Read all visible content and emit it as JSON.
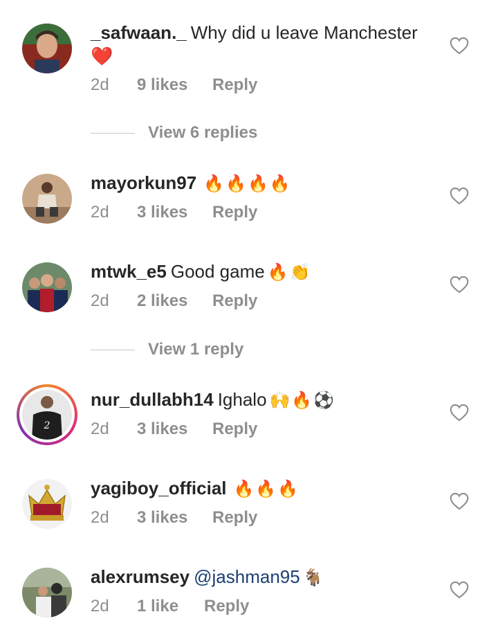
{
  "comments": [
    {
      "username": "_safwaan._",
      "text": "Why did u leave Manchester",
      "emoji_line": "❤️",
      "time": "2d",
      "likes": "9 likes",
      "reply": "Reply"
    },
    {
      "username": "mayorkun97",
      "text": "",
      "emoji": "🔥🔥🔥🔥",
      "time": "2d",
      "likes": "3 likes",
      "reply": "Reply"
    },
    {
      "username": "mtwk_e5",
      "text": "Good game",
      "emoji": "🔥👏",
      "time": "2d",
      "likes": "2 likes",
      "reply": "Reply"
    },
    {
      "username": "nur_dullabh14",
      "text": "Ighalo",
      "emoji": "🙌🔥⚽",
      "time": "2d",
      "likes": "3 likes",
      "reply": "Reply"
    },
    {
      "username": "yagiboy_official",
      "text": "",
      "emoji": "🔥🔥🔥",
      "time": "2d",
      "likes": "3 likes",
      "reply": "Reply"
    },
    {
      "username": "alexrumsey",
      "mention": "@jashman95",
      "emoji": "🐐",
      "time": "2d",
      "likes": "1 like",
      "reply": "Reply"
    }
  ],
  "view_replies": [
    {
      "label": "View 6 replies"
    },
    {
      "label": "View 1 reply"
    }
  ],
  "icons": {
    "like": "heart-outline-icon"
  },
  "colors": {
    "text": "#262626",
    "meta": "#8e8e8e",
    "mention": "#1c3f74",
    "divider": "#c7c7c7"
  }
}
